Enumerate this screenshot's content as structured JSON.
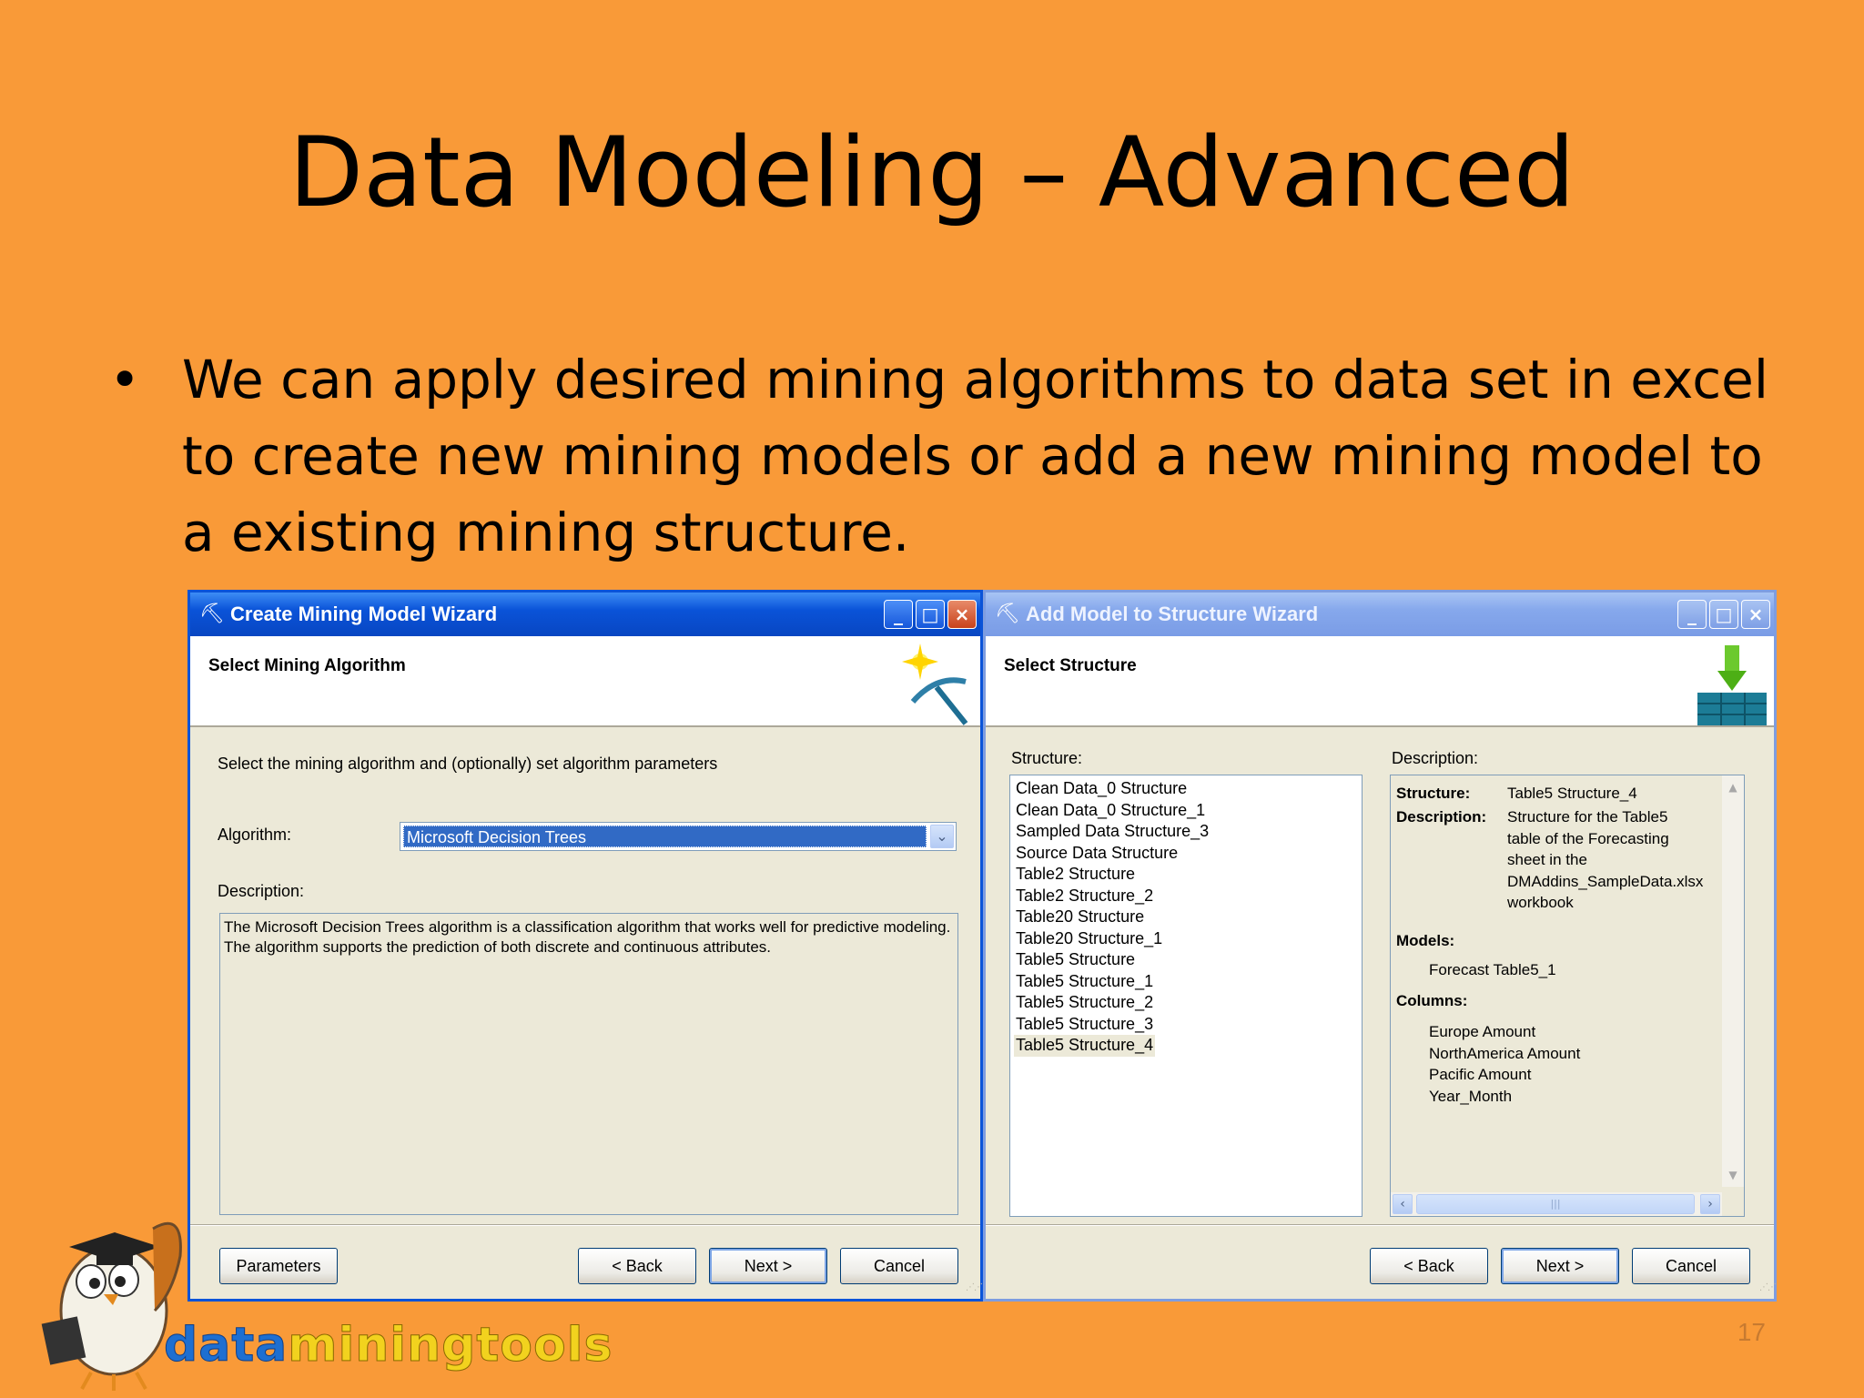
{
  "slide": {
    "title": "Data Modeling – Advanced",
    "bullet_symbol": "•",
    "bullet": "We can apply desired mining algorithms to data set in excel to create new mining models or add a new mining model to a existing mining structure.",
    "page_number": "17"
  },
  "left_window": {
    "title": "Create Mining Model Wizard",
    "header": "Select Mining Algorithm",
    "instruction": "Select the mining algorithm and (optionally) set algorithm parameters",
    "algorithm_label": "Algorithm:",
    "algorithm_value": "Microsoft Decision Trees",
    "description_label": "Description:",
    "description_text": "The Microsoft Decision Trees algorithm is a classification algorithm that works well for predictive modeling. The algorithm supports the prediction of both discrete and continuous attributes.",
    "buttons": {
      "parameters": "Parameters",
      "back": "< Back",
      "next": "Next >",
      "cancel": "Cancel"
    }
  },
  "right_window": {
    "title": "Add Model to Structure Wizard",
    "header": "Select Structure",
    "structure_label": "Structure:",
    "description_label": "Description:",
    "structures": [
      "Clean Data_0 Structure",
      "Clean Data_0 Structure_1",
      "Sampled Data Structure_3",
      "Source Data Structure",
      "Table2 Structure",
      "Table2 Structure_2",
      "Table20 Structure",
      "Table20 Structure_1",
      "Table5 Structure",
      "Table5 Structure_1",
      "Table5 Structure_2",
      "Table5 Structure_3",
      "Table5 Structure_4"
    ],
    "selected_structure": "Table5 Structure_4",
    "details": {
      "structure_key": "Structure:",
      "structure_value": "Table5 Structure_4",
      "description_key": "Description:",
      "description_lines": [
        "Structure for the Table5",
        "table of the Forecasting",
        "sheet in the",
        "DMAddins_SampleData.xlsx",
        "workbook"
      ],
      "models_key": "Models:",
      "models": [
        "Forecast Table5_1"
      ],
      "columns_key": "Columns:",
      "columns": [
        "Europe Amount",
        "NorthAmerica Amount",
        "Pacific Amount",
        "Year_Month"
      ]
    },
    "buttons": {
      "back": "< Back",
      "next": "Next >",
      "cancel": "Cancel"
    }
  },
  "logo": {
    "part1": "data",
    "part2": "miningtools"
  },
  "icons": {
    "window_icon": "pickaxe-icon",
    "left_header_icon": "sparkle-pickaxe-icon",
    "right_header_icon": "add-to-cube-icon"
  }
}
